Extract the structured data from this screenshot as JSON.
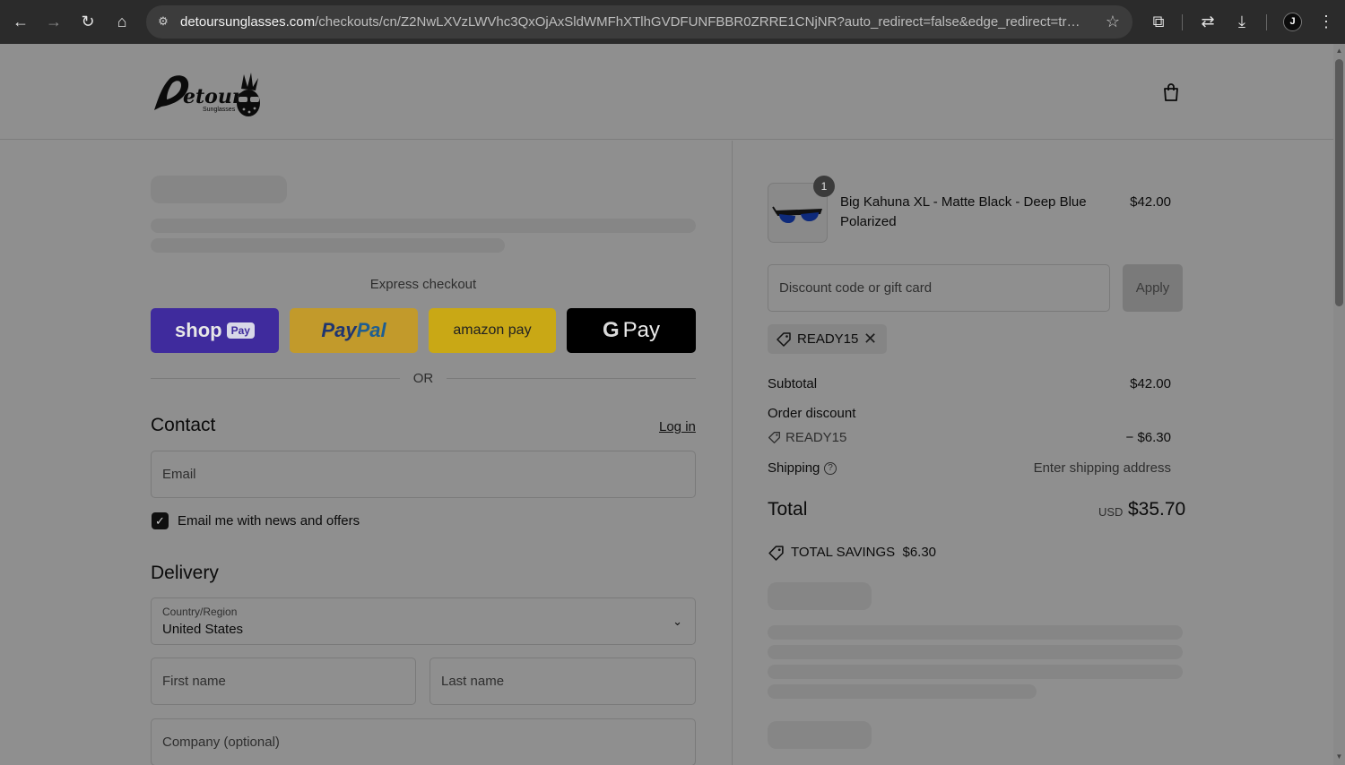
{
  "browser": {
    "url_domain": "detoursunglasses.com",
    "url_path": "/checkouts/cn/Z2NwLXVzLWVhc3QxOjAxSldWMFhXTlhGVDFUNFBBR0ZRRE1CNjNR?auto_redirect=false&edge_redirect=true&locale...",
    "profile_initial": "J"
  },
  "express": {
    "label": "Express checkout",
    "shop_text": "shop",
    "shop_badge": "Pay",
    "paypal_a": "Pay",
    "paypal_b": "Pal",
    "amazon_text": "amazon pay",
    "gpay_g": "G",
    "gpay_text": "Pay",
    "or_text": "OR"
  },
  "contact": {
    "heading": "Contact",
    "login": "Log in",
    "email_placeholder": "Email",
    "newsletter_label": "Email me with news and offers",
    "newsletter_checked": true
  },
  "delivery": {
    "heading": "Delivery",
    "country_label": "Country/Region",
    "country_value": "United States",
    "first_name_placeholder": "First name",
    "last_name_placeholder": "Last name",
    "company_placeholder": "Company (optional)"
  },
  "summary": {
    "product_name": "Big Kahuna XL - Matte Black - Deep Blue Polarized",
    "product_qty": "1",
    "product_price": "$42.00",
    "discount_placeholder": "Discount code or gift card",
    "apply_label": "Apply",
    "applied_code": "READY15",
    "subtotal_label": "Subtotal",
    "subtotal_value": "$42.00",
    "order_discount_label": "Order discount",
    "discount_code": "READY15",
    "discount_value": "− $6.30",
    "shipping_label": "Shipping",
    "shipping_value": "Enter shipping address",
    "total_label": "Total",
    "currency": "USD",
    "total_value": "$35.70",
    "savings_label": "TOTAL SAVINGS",
    "savings_value": "$6.30"
  },
  "icons": {
    "back": "back-arrow-icon",
    "forward": "forward-arrow-icon",
    "reload": "reload-icon",
    "home": "home-icon",
    "bag": "shopping-bag-icon",
    "tag": "tag-icon"
  }
}
